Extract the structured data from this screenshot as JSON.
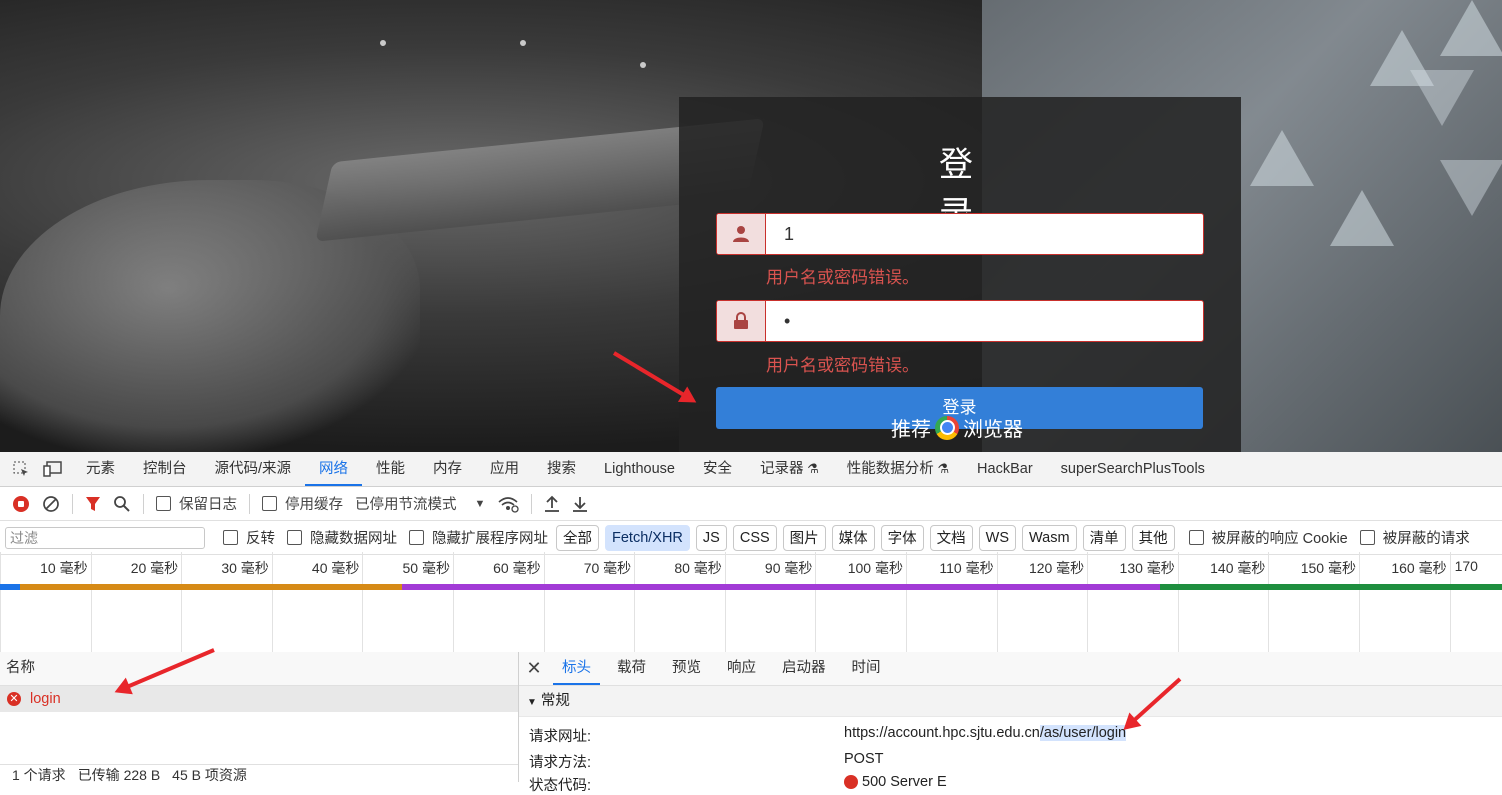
{
  "login": {
    "title": "登 录",
    "username_value": "1",
    "password_value": "•",
    "username_error": "用户名或密码错误。",
    "password_error": "用户名或密码错误。",
    "submit_label": "登录",
    "recommend_prefix": "推荐",
    "recommend_suffix": "浏览器"
  },
  "devtools": {
    "tabs": [
      "元素",
      "控制台",
      "源代码/来源",
      "网络",
      "性能",
      "内存",
      "应用",
      "搜索",
      "Lighthouse",
      "安全",
      "记录器",
      "性能数据分析",
      "HackBar",
      "superSearchPlusTools"
    ],
    "active_tab": "网络",
    "toolbar": {
      "preserve_log": "保留日志",
      "disable_cache": "停用缓存",
      "throttling": "已停用节流模式"
    },
    "filter": {
      "placeholder": "过滤",
      "invert": "反转",
      "hide_data_urls": "隐藏数据网址",
      "hide_extension_urls": "隐藏扩展程序网址",
      "types": [
        "全部",
        "Fetch/XHR",
        "JS",
        "CSS",
        "图片",
        "媒体",
        "字体",
        "文档",
        "WS",
        "Wasm",
        "清单",
        "其他"
      ],
      "active_type": "Fetch/XHR",
      "blocked_cookies": "被屏蔽的响应 Cookie",
      "blocked_requests": "被屏蔽的请求"
    },
    "timeline_ticks": [
      "10 毫秒",
      "20 毫秒",
      "30 毫秒",
      "40 毫秒",
      "50 毫秒",
      "60 毫秒",
      "70 毫秒",
      "80 毫秒",
      "90 毫秒",
      "100 毫秒",
      "110 毫秒",
      "120 毫秒",
      "130 毫秒",
      "140 毫秒",
      "150 毫秒",
      "160 毫秒",
      "170"
    ],
    "request_list": {
      "header": "名称",
      "rows": [
        {
          "name": "login",
          "status": "error"
        }
      ],
      "status_bar": [
        "1 个请求",
        "已传输 228 B",
        "45 B 项资源"
      ]
    },
    "details": {
      "tabs": [
        "标头",
        "载荷",
        "预览",
        "响应",
        "启动器",
        "时间"
      ],
      "active_tab": "标头",
      "section": "常规",
      "request_url_label": "请求网址:",
      "request_url_base": "https://account.hpc.sjtu.edu.cn",
      "request_url_path": "/as/user/login",
      "request_method_label": "请求方法:",
      "request_method": "POST",
      "status_code_label": "状态代码:",
      "status_code": "500 Server E"
    }
  },
  "colors": {
    "accent": "#1a73e8",
    "error": "#d93025",
    "login_button": "#337fd8",
    "annotation_arrow": "#e8262b"
  }
}
